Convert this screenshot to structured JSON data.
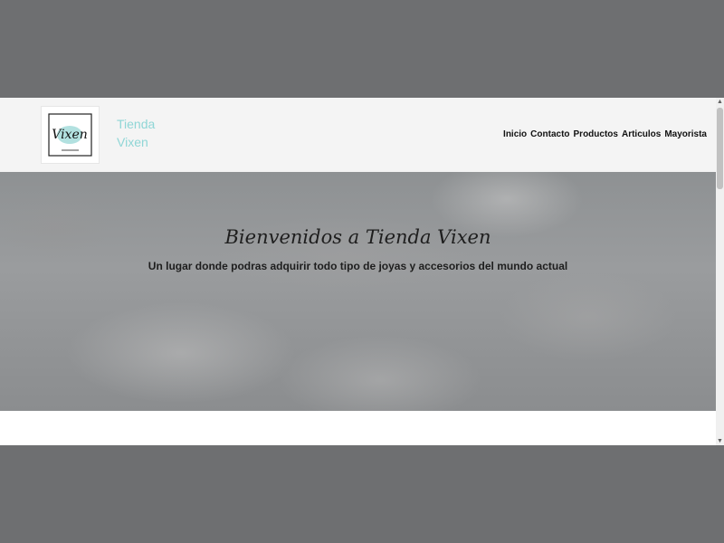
{
  "brand": {
    "line1": "Tienda",
    "line2": "Vixen",
    "logo_text": "Vixen",
    "logo_icon": "vixen-logo",
    "color": "#8fd6d6"
  },
  "nav": {
    "items": [
      "Inicio",
      "Contacto",
      "Productos",
      "Articulos",
      "Mayorista"
    ]
  },
  "hero": {
    "title": "Bienvenidos a Tienda Vixen",
    "subtitle": "Un lugar donde podras adquirir todo tipo de joyas y accesorios del mundo actual"
  },
  "colors": {
    "backdrop": "#6e6f71",
    "header_bg": "#f4f4f4",
    "text": "#1e1e1e"
  }
}
